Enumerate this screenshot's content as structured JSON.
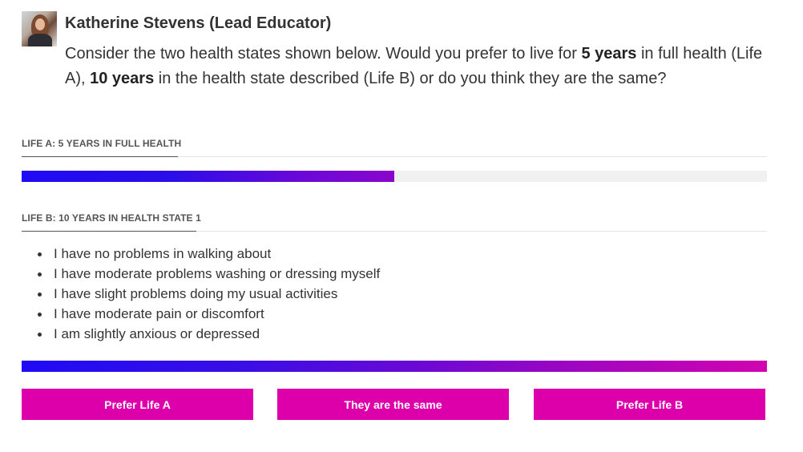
{
  "header": {
    "author": "Katherine Stevens (Lead Educator)",
    "question": {
      "part1": "Consider the two health states shown below. Would you prefer to live for ",
      "bold1": "5 years",
      "part2": " in full health (Life A), ",
      "bold2": "10 years",
      "part3": " in the health state described (Life B) or do you think they are the same?"
    }
  },
  "life_a": {
    "title": "LIFE A: 5 YEARS IN FULL HEALTH",
    "bar_fill_fraction": 0.5
  },
  "life_b": {
    "title": "LIFE B: 10 YEARS IN HEALTH STATE 1",
    "states": [
      "I have no problems in walking about",
      "I have moderate problems washing or dressing myself",
      "I have slight problems doing my usual activities",
      "I have moderate pain or discomfort",
      "I am slightly anxious or depressed"
    ],
    "bar_fill_fraction": 1.0
  },
  "buttons": {
    "prefer_a": "Prefer Life A",
    "same": "They are the same",
    "prefer_b": "Prefer Life B"
  },
  "colors": {
    "button": "#dd00aa",
    "bar_start": "#1f0bf5",
    "bar_end": "#d204b0"
  }
}
